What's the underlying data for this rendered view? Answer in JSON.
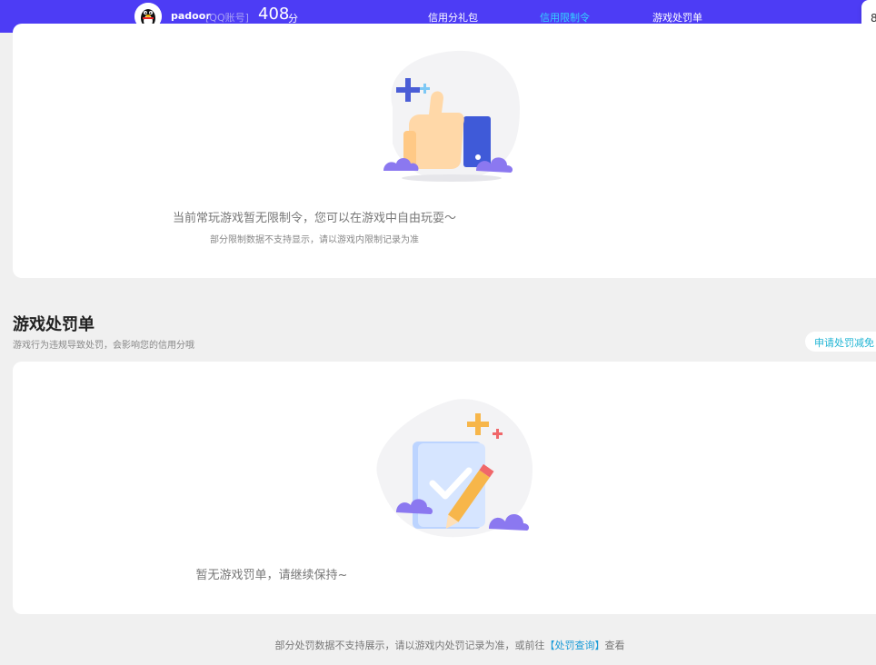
{
  "header": {
    "username": "padoor",
    "account_type": "[QQ账号]",
    "score": "408",
    "score_unit": "分",
    "tabs": [
      {
        "label": "信用分礼包",
        "active": false
      },
      {
        "label": "信用限制令",
        "active": true
      },
      {
        "label": "游戏处罚单",
        "active": false
      }
    ],
    "corner_text": "8",
    "accent_color": "#35d3ff",
    "bar_color": "#4d3cf5"
  },
  "restriction_card": {
    "icon": "thumbs-up-illustration",
    "message": "当前常玩游戏暂无限制令，您可以在游戏中自由玩耍～",
    "note": "部分限制数据不支持显示，请以游戏内限制记录为准"
  },
  "penalty_section": {
    "title": "游戏处罚单",
    "subtitle": "游戏行为违规导致处罚，会影响您的信用分哦",
    "appeal_label": "申请处罚减免",
    "card": {
      "icon": "clipboard-check-illustration",
      "message": "暂无游戏罚单，请继续保持~"
    }
  },
  "footer": {
    "text_before": "部分处罚数据不支持展示，请以游戏内处罚记录为准，或前往",
    "link_label": "【处罚查询】",
    "text_after": "查看"
  }
}
